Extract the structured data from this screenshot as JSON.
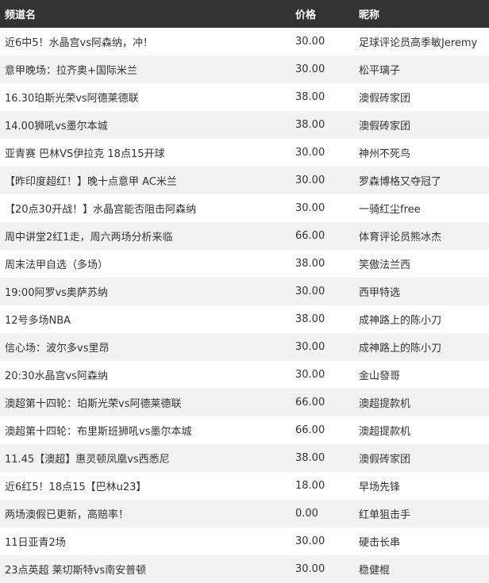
{
  "table": {
    "headers": {
      "channel": "频道名",
      "price": "价格",
      "nickname": "昵称"
    },
    "rows": [
      {
        "channel": "近6中5！水晶宫vs阿森纳，冲！",
        "price": "30.00",
        "nickname": "足球评论员高季敏Jeremy"
      },
      {
        "channel": "意甲晚场：拉齐奥+国际米兰",
        "price": "30.00",
        "nickname": "松平璃子"
      },
      {
        "channel": "16.30珀斯光荣vs阿德莱德联",
        "price": "38.00",
        "nickname": "澳假砖家团"
      },
      {
        "channel": "14.00狮吼vs墨尔本城",
        "price": "38.00",
        "nickname": "澳假砖家团"
      },
      {
        "channel": "亚青赛 巴林VS伊拉克 18点15开球",
        "price": "30.00",
        "nickname": "神州不死鸟"
      },
      {
        "channel": "【昨印度超红！】晚十点意甲 AC米兰",
        "price": "30.00",
        "nickname": "罗森博格又夺冠了"
      },
      {
        "channel": "【20点30开战！】水晶宫能否阻击阿森纳",
        "price": "30.00",
        "nickname": "一骑红尘free"
      },
      {
        "channel": "周中讲堂2红1走，周六两场分析来临",
        "price": "66.00",
        "nickname": "体育评论员熊冰杰"
      },
      {
        "channel": "周末法甲自选（多场）",
        "price": "38.00",
        "nickname": "笑傲法兰西"
      },
      {
        "channel": "19:00阿罗vs奥萨苏纳",
        "price": "30.00",
        "nickname": "西甲特选"
      },
      {
        "channel": "12号多场NBA",
        "price": "38.00",
        "nickname": "成神路上的陈小刀"
      },
      {
        "channel": "信心场：波尔多vs里昂",
        "price": "30.00",
        "nickname": "成神路上的陈小刀"
      },
      {
        "channel": "20:30水晶宫vs阿森纳",
        "price": "30.00",
        "nickname": "金山發哥"
      },
      {
        "channel": "澳超第十四轮：珀斯光荣vs阿德莱德联",
        "price": "66.00",
        "nickname": "澳超提款机"
      },
      {
        "channel": "澳超第十四轮：布里斯班狮吼vs墨尔本城",
        "price": "66.00",
        "nickname": "澳超提款机"
      },
      {
        "channel": "11.45【澳超】惠灵顿凤凰vs西悉尼",
        "price": "38.00",
        "nickname": "澳假砖家团"
      },
      {
        "channel": "近6红5！18点15【巴林u23】",
        "price": "18.00",
        "nickname": "早场先锋"
      },
      {
        "channel": "两场澳假已更新，高赔率！",
        "price": "0.00",
        "nickname": "红单狙击手"
      },
      {
        "channel": "11日亚青2场",
        "price": "30.00",
        "nickname": "硬击长串"
      },
      {
        "channel": "23点英超 莱切斯特vs南安普顿",
        "price": "30.00",
        "nickname": "稳健棍"
      }
    ]
  }
}
